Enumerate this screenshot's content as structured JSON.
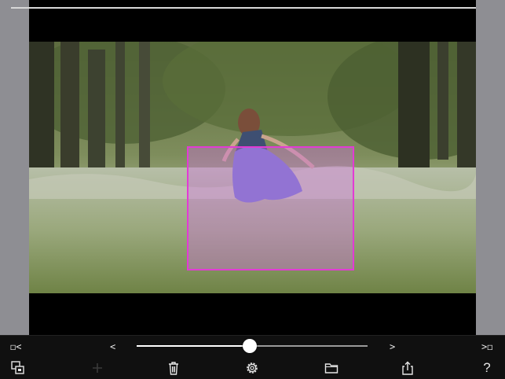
{
  "toolbar": {
    "trim_start_label": "◻<",
    "trim_end_label": ">◻",
    "prev_label": "<",
    "next_label": ">",
    "help_label": "?",
    "slider_progress": 0.49
  },
  "icons": {
    "layers": "layers-icon",
    "add": "plus-icon",
    "delete": "trash-icon",
    "settings": "gear-icon",
    "folder": "folder-icon",
    "share": "share-icon",
    "help": "help-icon"
  },
  "colors": {
    "selection_border": "#e23bd4",
    "selection_fill": "#d26ee6",
    "toolbar_bg": "#101010",
    "side_panel": "#8e8e93"
  }
}
